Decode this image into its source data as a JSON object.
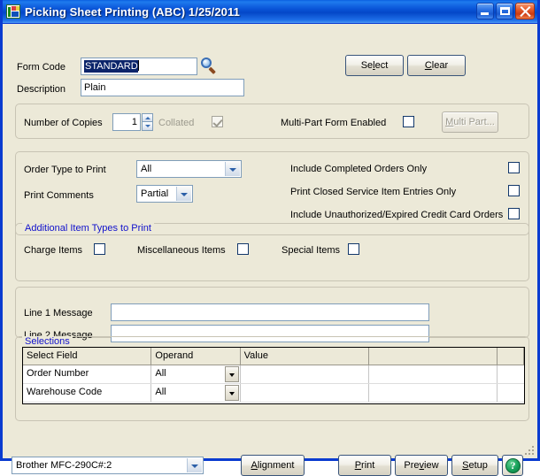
{
  "window": {
    "title": "Picking Sheet Printing (ABC) 1/25/2011",
    "icon": "mas-app-icon",
    "minimize_label": "Minimize",
    "maximize_label": "Maximize",
    "close_label": "Close"
  },
  "form": {
    "form_code_label": "Form Code",
    "form_code_value": "STANDARD",
    "form_code_lookup_icon": "magnifier-icon",
    "description_label": "Description",
    "description_value": "Plain",
    "select_button": "Select",
    "select_accel": "l",
    "clear_button": "Clear",
    "clear_accel": "C"
  },
  "copies": {
    "number_of_copies_label": "Number of Copies",
    "number_of_copies_value": "1",
    "collated_label": "Collated",
    "collated_checked": true,
    "collated_enabled": false,
    "multi_part_label": "Multi-Part Form Enabled",
    "multi_part_checked": false,
    "multi_part_button": "Multi Part...",
    "multi_part_button_accel": "M",
    "multi_part_button_enabled": false
  },
  "options": {
    "order_type_label": "Order Type to Print",
    "order_type_value": "All",
    "print_comments_label": "Print Comments",
    "print_comments_value": "Partial",
    "checkboxes": [
      {
        "label": "Include Completed Orders Only",
        "checked": false
      },
      {
        "label": "Print Closed Service Item Entries Only",
        "checked": false
      },
      {
        "label": "Include Unauthorized/Expired Credit Card Orders",
        "checked": false
      }
    ]
  },
  "additional_items": {
    "legend": "Additional Item Types to Print",
    "items": [
      {
        "label": "Charge Items",
        "checked": false
      },
      {
        "label": "Miscellaneous Items",
        "checked": false
      },
      {
        "label": "Special Items",
        "checked": false
      }
    ]
  },
  "messages": {
    "line1_label": "Line 1 Message",
    "line1_value": "",
    "line2_label": "Line 2 Message",
    "line2_value": ""
  },
  "selections": {
    "legend": "Selections",
    "columns": [
      "Select Field",
      "Operand",
      "Value",
      "",
      ""
    ],
    "rows": [
      {
        "select_field": "Order Number",
        "operand": "All",
        "value": "",
        "value2": ""
      },
      {
        "select_field": "Warehouse Code",
        "operand": "All",
        "value": "",
        "value2": ""
      }
    ]
  },
  "footer": {
    "printer_value": "Brother MFC-290C#:2",
    "alignment_button": "Alignment",
    "alignment_accel": "A",
    "print_button": "Print",
    "print_accel": "P",
    "preview_button": "Preview",
    "preview_accel": "v",
    "setup_button": "Setup",
    "setup_accel": "S",
    "help_button": "?"
  },
  "colors": {
    "window_bg": "#ECE9D8",
    "title_blue": "#0A55D8",
    "legend_blue": "#1111CC",
    "selection_blue": "#0A246A",
    "help_green": "#17A05A"
  }
}
